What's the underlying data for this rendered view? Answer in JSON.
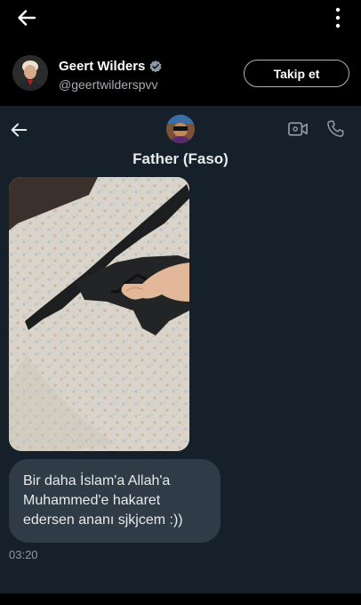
{
  "tweet_header": {
    "back_icon": "arrow-left-icon",
    "more_icon": "more-vertical-icon"
  },
  "author": {
    "name": "Geert Wilders",
    "handle": "@geertwilderspvv",
    "follow_label": "Takip et",
    "verified_icon": "verified-badge-icon"
  },
  "chat": {
    "contact_name": "Father (Faso)",
    "back_icon": "arrow-left-icon",
    "video_icon": "video-call-icon",
    "phone_icon": "phone-icon",
    "message_text": "Bir daha İslam'a Allah'a Muhammed'e hakaret edersen ananı sjkjcem :))",
    "message_time": "03:20"
  },
  "colors": {
    "page_bg": "#000000",
    "chat_bg": "#15202b",
    "bubble_bg": "#2f3c47",
    "verified": "#8b98a5",
    "text_primary": "#e7e9ea",
    "text_secondary": "#8b98a5"
  }
}
